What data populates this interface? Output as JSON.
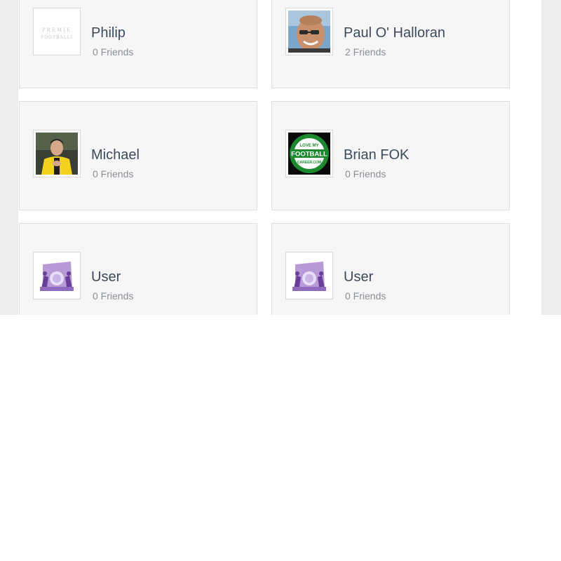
{
  "members": [
    {
      "name": "Philip",
      "friends": "0 Friends",
      "avatar_icon": "premier-football-logo-icon"
    },
    {
      "name": "Paul O' Halloran",
      "friends": "2 Friends",
      "avatar_icon": "profile-photo-icon"
    },
    {
      "name": "Michael",
      "friends": "0 Friends",
      "avatar_icon": "profile-photo-icon"
    },
    {
      "name": "Brian FOK",
      "friends": "0 Friends",
      "avatar_icon": "love-my-football-career-logo-icon"
    },
    {
      "name": "User",
      "friends": "0 Friends",
      "avatar_icon": "default-user-avatar-icon"
    },
    {
      "name": "User",
      "friends": "0 Friends",
      "avatar_icon": "default-user-avatar-icon"
    }
  ],
  "logos": {
    "premier_top": "PREMIE",
    "premier_bottom": "FOOTBALLI",
    "lmf_top": "LOVE MY",
    "lmf_main": "FOOTBALL",
    "lmf_bottom": "CAREER.COM"
  }
}
